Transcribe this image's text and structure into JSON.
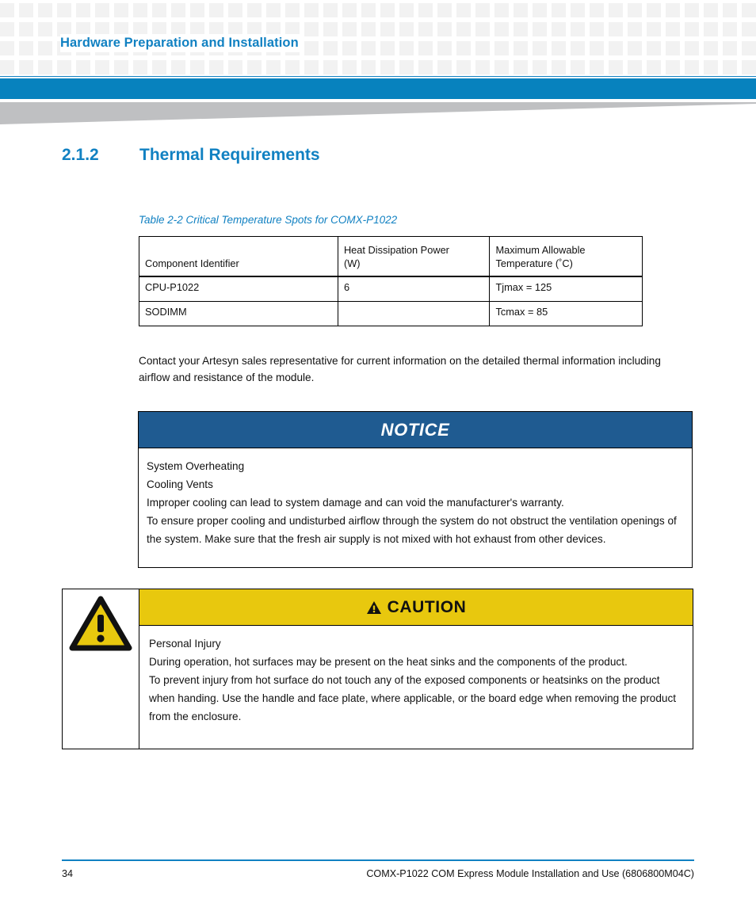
{
  "header": {
    "chapter_title": "Hardware Preparation and Installation",
    "accent_blue": "#0782be",
    "title_blue": "#1181c2",
    "wedge_gray": "#bfc0c2"
  },
  "section": {
    "number": "2.1.2",
    "title": "Thermal Requirements"
  },
  "table": {
    "caption": "Table 2-2 Critical Temperature Spots for COMX-P1022",
    "headers": [
      "Component Identifier",
      "Heat Dissipation Power (W)",
      "Maximum Allowable Temperature (˚C)"
    ],
    "headers_line1": [
      "",
      "Heat Dissipation Power",
      "Maximum Allowable"
    ],
    "headers_line2": [
      "Component Identifier",
      "(W)",
      "Temperature (˚C)"
    ],
    "rows": [
      [
        "CPU-P1022",
        "6",
        "Tjmax = 125"
      ],
      [
        "SODIMM",
        "",
        "Tcmax = 85"
      ]
    ]
  },
  "paragraph": "Contact your Artesyn sales representative for current information on the detailed thermal information including airflow and resistance of the module.",
  "notice": {
    "banner_label": "NOTICE",
    "banner_color": "#1f5b91",
    "lines": [
      "System Overheating",
      "Cooling Vents",
      "Improper cooling can lead to system damage and can void the manufacturer's warranty.",
      "To ensure proper cooling and undisturbed airflow through the system do not obstruct the ventilation openings of the system. Make sure that the fresh air supply is not mixed with hot exhaust from other devices."
    ]
  },
  "caution": {
    "banner_label": "CAUTION",
    "banner_color": "#e8c80e",
    "icon": "warning-triangle-icon",
    "lines": [
      "Personal Injury",
      "During operation, hot surfaces may be present on the heat sinks and the components of the product.",
      "To prevent injury from hot surface do not touch any of the exposed components or heatsinks on the product when handing. Use the handle and face plate, where applicable, or the board edge when removing the product from the enclosure."
    ]
  },
  "footer": {
    "page_number": "34",
    "document_title": "COMX-P1022 COM Express Module Installation and Use (6806800M04C)"
  }
}
